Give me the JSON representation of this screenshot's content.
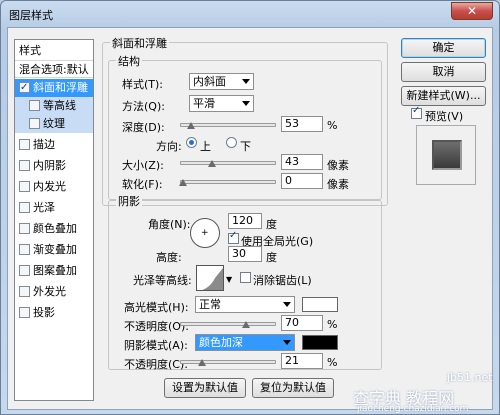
{
  "window": {
    "title": "图层样式",
    "close_glyph": "✕"
  },
  "style_list": {
    "header": "样式",
    "blend_options": "混合选项:默认",
    "items": [
      {
        "label": "斜面和浮雕",
        "checked": true,
        "selected": true
      },
      {
        "label": "等高线",
        "checked": false,
        "sub": true
      },
      {
        "label": "纹理",
        "checked": false,
        "sub": true
      },
      {
        "label": "描边",
        "checked": false
      },
      {
        "label": "内阴影",
        "checked": false
      },
      {
        "label": "内发光",
        "checked": false
      },
      {
        "label": "光泽",
        "checked": false
      },
      {
        "label": "颜色叠加",
        "checked": false
      },
      {
        "label": "渐变叠加",
        "checked": false
      },
      {
        "label": "图案叠加",
        "checked": false
      },
      {
        "label": "外发光",
        "checked": false
      },
      {
        "label": "投影",
        "checked": false
      }
    ]
  },
  "bevel": {
    "group_title": "斜面和浮雕",
    "structure_title": "结构",
    "style_label": "样式(T):",
    "style_value": "内斜面",
    "method_label": "方法(Q):",
    "method_value": "平滑",
    "depth_label": "深度(D):",
    "depth_value": "53",
    "depth_unit": "%",
    "direction_label": "方向:",
    "dir_up": "上",
    "dir_down": "下",
    "size_label": "大小(Z):",
    "size_value": "43",
    "size_unit": "像素",
    "soften_label": "软化(F):",
    "soften_value": "0",
    "soften_unit": "像素"
  },
  "shading": {
    "title": "阴影",
    "angle_label": "角度(N):",
    "angle_value": "120",
    "angle_unit": "度",
    "global_light_label": "使用全局光(G)",
    "altitude_label": "高度:",
    "altitude_value": "30",
    "altitude_unit": "度",
    "gloss_label": "光泽等高线:",
    "antialias_label": "消除锯齿(L)",
    "highlight_mode_label": "高光模式(H):",
    "highlight_mode_value": "正常",
    "highlight_opacity_label": "不透明度(O):",
    "highlight_opacity_value": "70",
    "highlight_opacity_unit": "%",
    "shadow_mode_label": "阴影模式(A):",
    "shadow_mode_value": "颜色加深",
    "shadow_opacity_label": "不透明度(C):",
    "shadow_opacity_value": "21",
    "shadow_opacity_unit": "%"
  },
  "bottom_buttons": {
    "set_default": "设置为默认值",
    "reset_default": "复位为默认值"
  },
  "right_panel": {
    "ok": "确定",
    "cancel": "取消",
    "new_style": "新建样式(W)...",
    "preview_label": "预览(V)"
  },
  "watermark": {
    "main": "查字典 教程网",
    "sub": "jiaocheng.chazidian.com",
    "corner": "jb51.net"
  },
  "colors": {
    "highlight": "#ffffff",
    "shadow": "#000000",
    "selection": "#3399ff"
  }
}
